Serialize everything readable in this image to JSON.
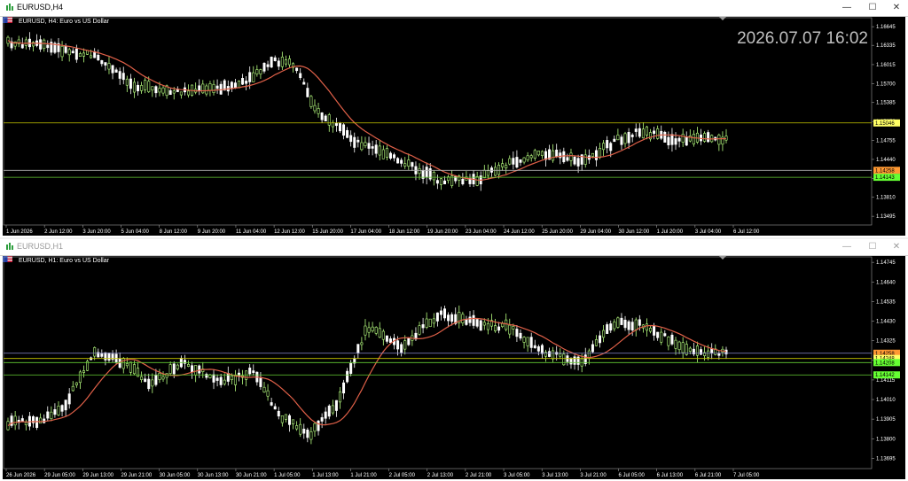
{
  "windows": [
    {
      "title": "EURUSD,H4",
      "symbol_desc": "EURUSD, H4:  Euro vs US Dollar",
      "clock": "2026.07.07 16:02",
      "price_labels": [
        "1.16645",
        "1.16335",
        "1.16015",
        "1.15700",
        "1.15385",
        "1.15070",
        "1.14755",
        "1.14440",
        "1.14125",
        "1.13810",
        "1.13495"
      ],
      "badges": [
        {
          "text": "1.15046",
          "price": 1.15046,
          "color": "#ffff66"
        },
        {
          "text": "1.14258",
          "price": 1.14258,
          "color": "#ff9933"
        },
        {
          "text": "1.14143",
          "price": 1.14143,
          "color": "#66ff33"
        }
      ],
      "hlines": [
        {
          "price": 1.15046,
          "color": "#c8c800"
        },
        {
          "price": 1.14258,
          "color": "#b0b0b0"
        },
        {
          "price": 1.14143,
          "color": "#66cc33"
        }
      ],
      "time_labels": [
        "1 Jun 2026",
        "2 Jun 12:00",
        "3 Jun 20:00",
        "5 Jun 04:00",
        "8 Jun 12:00",
        "9 Jun 20:00",
        "11 Jun 04:00",
        "12 Jun 12:00",
        "15 Jun 20:00",
        "17 Jun 04:00",
        "18 Jun 12:00",
        "19 Jun 20:00",
        "23 Jun 04:00",
        "24 Jun 12:00",
        "25 Jun 20:00",
        "29 Jun 04:00",
        "30 Jun 12:00",
        "1 Jul 20:00",
        "3 Jul 04:00",
        "6 Jul 12:00"
      ],
      "price_range": [
        1.1335,
        1.1675
      ]
    },
    {
      "title": "EURUSD,H1",
      "symbol_desc": "EURUSD, H1:  Euro vs US Dollar",
      "price_labels": [
        "1.14745",
        "1.14640",
        "1.14535",
        "1.14430",
        "1.14325",
        "1.14220",
        "1.14115",
        "1.14010",
        "1.13905",
        "1.13800",
        "1.13695"
      ],
      "badges": [
        {
          "text": "1.14258",
          "price": 1.14258,
          "color": "#ff9933"
        },
        {
          "text": "1.14248",
          "price": 1.1423,
          "color": "#ffff66"
        },
        {
          "text": "1.14208",
          "price": 1.14208,
          "color": "#66ff33"
        },
        {
          "text": "1.14142",
          "price": 1.14142,
          "color": "#66ff33"
        }
      ],
      "hlines": [
        {
          "price": 1.14258,
          "color": "#8888cc"
        },
        {
          "price": 1.1423,
          "color": "#c8c800"
        },
        {
          "price": 1.14208,
          "color": "#66cc33"
        },
        {
          "price": 1.14142,
          "color": "#66cc33"
        }
      ],
      "time_labels": [
        "26 Jun 2026",
        "29 Jun 05:00",
        "29 Jun 13:00",
        "29 Jun 21:00",
        "30 Jun 05:00",
        "30 Jun 13:00",
        "30 Jun 21:00",
        "1 Jul 05:00",
        "1 Jul 13:00",
        "1 Jul 21:00",
        "2 Jul 05:00",
        "2 Jul 13:00",
        "2 Jul 21:00",
        "3 Jul 05:00",
        "3 Jul 13:00",
        "3 Jul 21:00",
        "6 Jul 05:00",
        "6 Jul 13:00",
        "6 Jul 21:00",
        "7 Jul 05:00"
      ],
      "price_range": [
        1.1364,
        1.1476
      ]
    }
  ],
  "colors": {
    "bull": "#b8ff80",
    "bear": "#ffffff",
    "ma": "#e06048",
    "bg": "#000000"
  },
  "icons": {
    "app": "chart-window-icon",
    "flag": "eu-us-flag-icon",
    "minimize": "minimize-icon",
    "maximize": "maximize-icon",
    "close": "close-icon"
  },
  "buttons": {
    "minimize": "—",
    "maximize": "☐",
    "close": "✕"
  }
}
